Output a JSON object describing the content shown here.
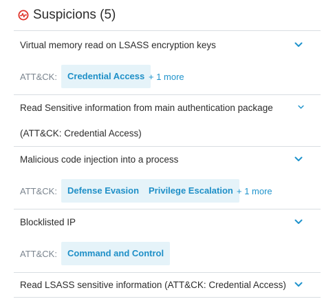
{
  "header": {
    "title": "Suspicions (5)",
    "icon": "suspicion-pulse-icon",
    "icon_color": "#e0342b"
  },
  "attck_label": "ATT&CK:",
  "suspicions": [
    {
      "title": "Virtual memory read on LSASS encryption keys",
      "tags": [
        "Credential Access"
      ],
      "more": "+ 1 more"
    },
    {
      "title": "Read Sensitive information from main authentication package (ATT&CK: Credential Access)"
    },
    {
      "title": "Malicious code injection into a process",
      "tags": [
        "Defense Evasion",
        "Privilege Escalation"
      ],
      "more": "+ 1 more"
    },
    {
      "title": "Blocklisted IP",
      "tags": [
        "Command and Control"
      ]
    },
    {
      "title": "Read LSASS sensitive information (ATT&CK: Credential Access)"
    }
  ],
  "colors": {
    "accent": "#1f93cc",
    "tag_bg": "#e5f3f9",
    "divider": "#d8dde2",
    "muted": "#7b858f"
  }
}
